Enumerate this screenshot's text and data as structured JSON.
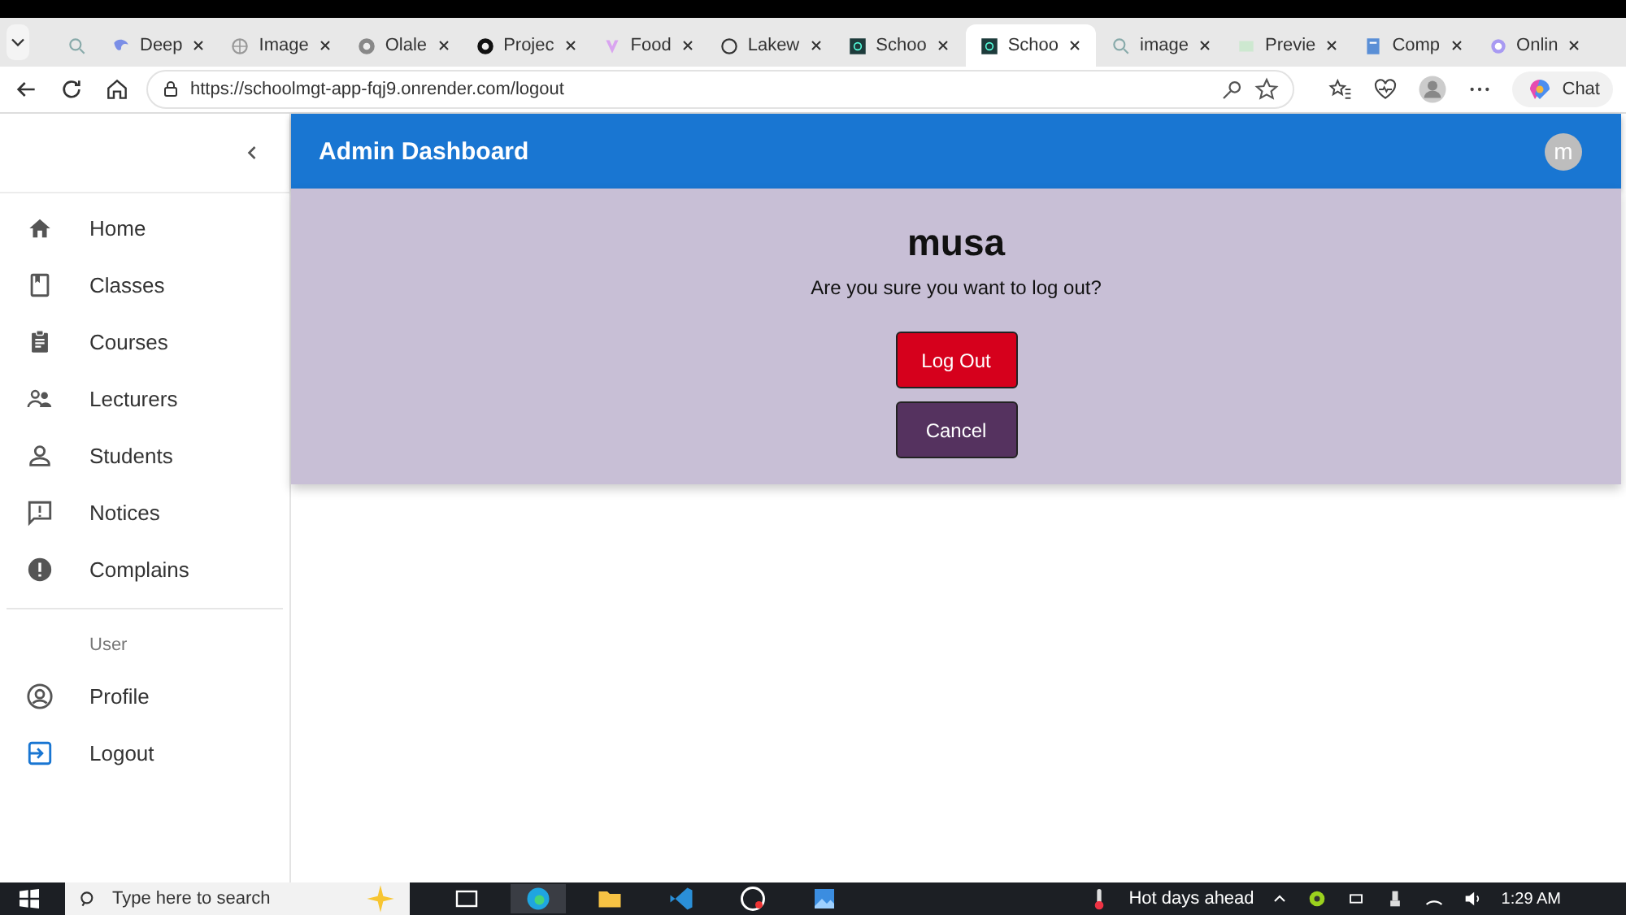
{
  "browser": {
    "tabs": [
      {
        "kind": "icon",
        "selected": false
      },
      {
        "label": "Deep",
        "selected": false
      },
      {
        "label": "Image",
        "selected": false
      },
      {
        "label": "Olale",
        "selected": false
      },
      {
        "label": "Projec",
        "selected": false
      },
      {
        "label": "Food",
        "selected": false
      },
      {
        "label": "Lakew",
        "selected": false
      },
      {
        "label": "Schoo",
        "selected": false
      },
      {
        "label": "Schoo",
        "selected": true
      },
      {
        "label": "image",
        "selected": false
      },
      {
        "label": "Previe",
        "selected": false
      },
      {
        "label": "Comp",
        "selected": false
      },
      {
        "label": "Onlin",
        "selected": false
      }
    ],
    "address": "https://schoolmgt-app-fqj9.onrender.com/logout",
    "chat_label": "Chat"
  },
  "app": {
    "title": "Admin Dashboard",
    "avatar_letter": "m",
    "sidebar": {
      "items": [
        {
          "label": "Home",
          "selected": false
        },
        {
          "label": "Classes",
          "selected": false
        },
        {
          "label": "Courses",
          "selected": false
        },
        {
          "label": "Lecturers",
          "selected": false
        },
        {
          "label": "Students",
          "selected": false
        },
        {
          "label": "Notices",
          "selected": false
        },
        {
          "label": "Complains",
          "selected": false
        }
      ],
      "section_title": "User",
      "user_items": [
        {
          "label": "Profile",
          "selected": false
        },
        {
          "label": "Logout",
          "selected": true
        }
      ]
    },
    "logout_card": {
      "username": "musa",
      "question": "Are you sure you want to log out?",
      "confirm_button": "Log Out",
      "cancel_button": "Cancel"
    }
  },
  "taskbar": {
    "search_placeholder": "Type here to search",
    "weather": "Hot days ahead",
    "time": "1:29 AM"
  }
}
